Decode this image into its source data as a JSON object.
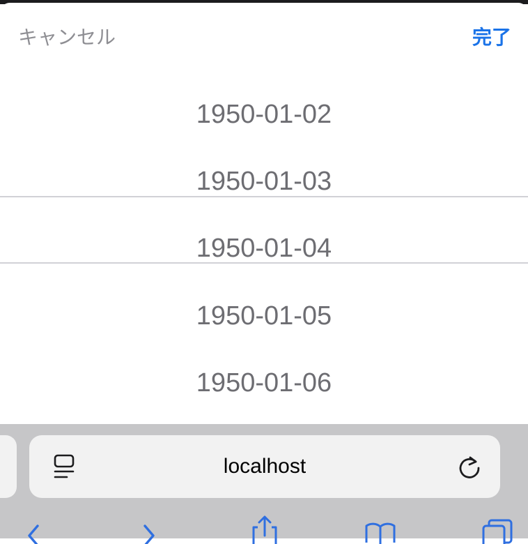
{
  "picker": {
    "cancel_label": "キャンセル",
    "done_label": "完了",
    "options": [
      "1950-01-02",
      "1950-01-03",
      "1950-01-04",
      "1950-01-05",
      "1950-01-06"
    ],
    "selected_value": "1950-01-04"
  },
  "browser": {
    "address": "localhost"
  },
  "icons": {
    "reader": "reader-icon",
    "reload": "reload-icon",
    "back": "chevron-left-icon",
    "forward": "chevron-right-icon",
    "share": "share-icon",
    "bookmarks": "book-icon",
    "tabs": "tabs-icon"
  },
  "colors": {
    "accent": "#1a73e8",
    "toolbar_icon": "#2f6fe0",
    "picker_text": "#6d6d72"
  }
}
